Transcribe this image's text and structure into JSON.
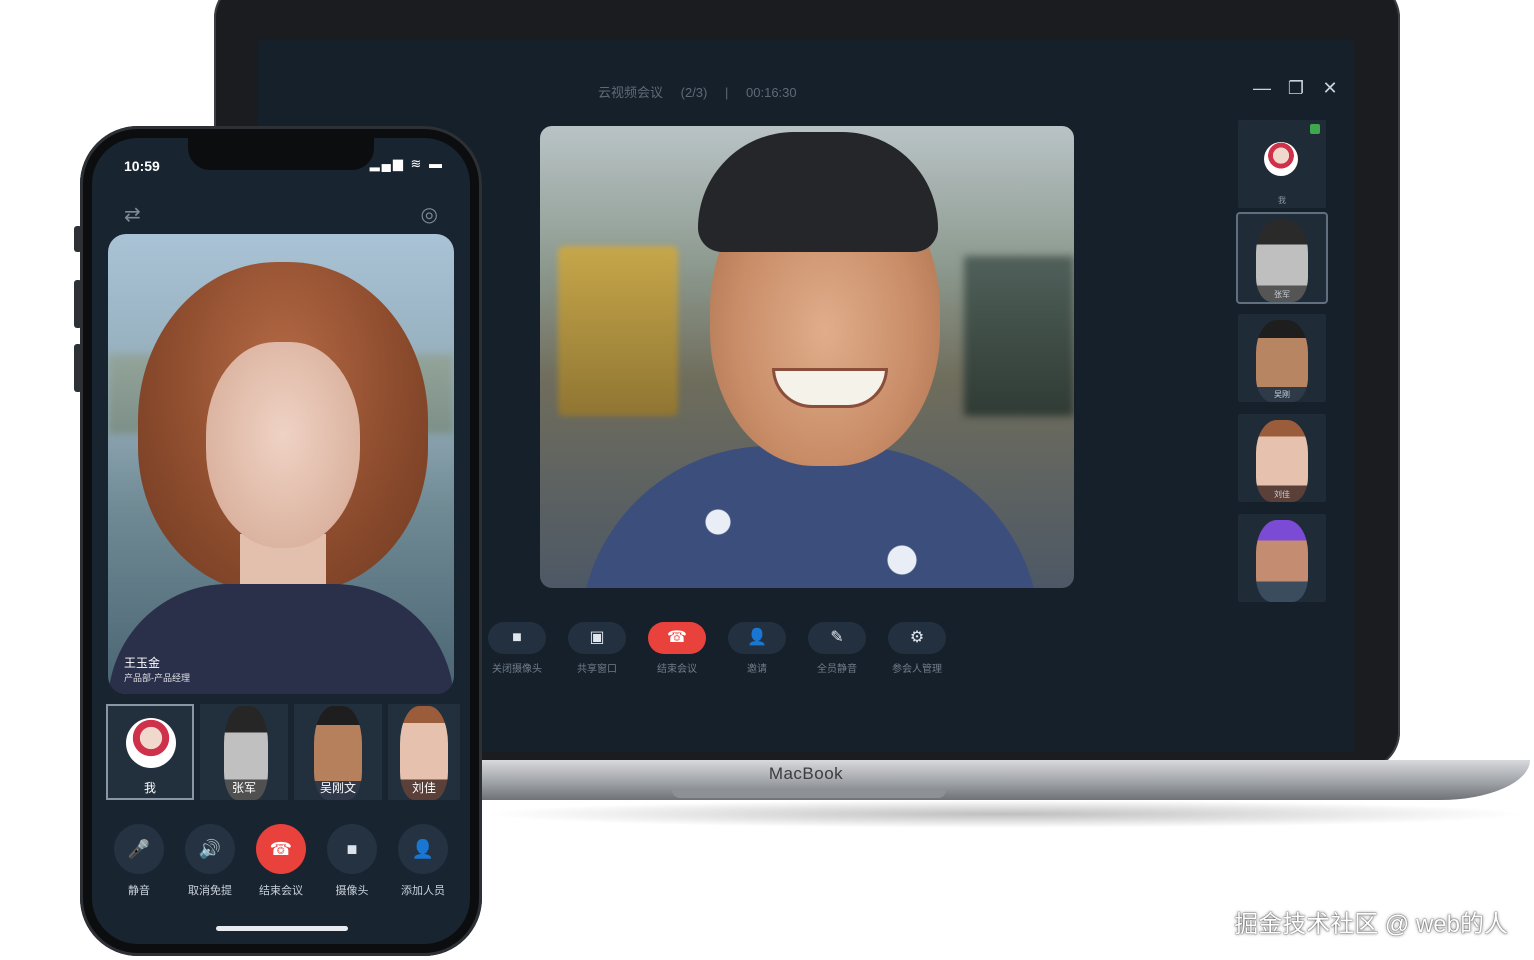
{
  "laptop": {
    "brand": "MacBook",
    "meeting": {
      "title": "云视频会议",
      "count": "(2/3)",
      "separator": "|",
      "duration": "00:16:30"
    },
    "window_controls": {
      "minimize": "—",
      "restore": "❐",
      "close": "✕"
    },
    "controls": [
      {
        "label": "关闭摄像头",
        "icon": "camera-icon"
      },
      {
        "label": "共享窗口",
        "icon": "screen-share-icon"
      },
      {
        "label": "结束会议",
        "icon": "hang-up-icon"
      },
      {
        "label": "邀请",
        "icon": "add-person-icon"
      },
      {
        "label": "全员静音",
        "icon": "mute-all-icon"
      },
      {
        "label": "参会人管理",
        "icon": "manage-participants-icon"
      }
    ],
    "participants": [
      {
        "label": "我"
      },
      {
        "label": "张军"
      },
      {
        "label": "吴刚"
      },
      {
        "label": "刘佳"
      },
      {
        "label": ""
      }
    ]
  },
  "phone": {
    "time": "10:59",
    "status_icons": "▂▄▆ ≋ ▬",
    "switch_icon": "⇄",
    "camera_icon": "◎",
    "speaker": {
      "name": "王玉金",
      "title": "产品部-产品经理"
    },
    "thumbnails": [
      {
        "label": "我"
      },
      {
        "label": "张军"
      },
      {
        "label": "吴刚文"
      },
      {
        "label": "刘佳"
      }
    ],
    "controls": [
      {
        "label": "静音",
        "glyph": "🎤"
      },
      {
        "label": "取消免提",
        "glyph": "🔊"
      },
      {
        "label": "结束会议",
        "glyph": "☎"
      },
      {
        "label": "摄像头",
        "glyph": "■"
      },
      {
        "label": "添加人员",
        "glyph": "👤"
      }
    ]
  },
  "watermark": "掘金技术社区 @ web的人",
  "colors": {
    "hangup": "#e9413c",
    "screen_bg": "#16202b",
    "active_badge": "#3fa84d"
  }
}
